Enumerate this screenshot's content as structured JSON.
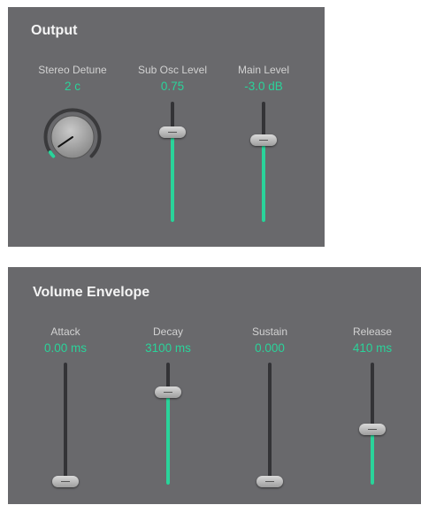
{
  "output": {
    "title": "Output",
    "stereo_detune": {
      "label": "Stereo Detune",
      "value": "2 c",
      "level": 0.04
    },
    "sub_osc_level": {
      "label": "Sub Osc Level",
      "value": "0.75",
      "level": 0.75
    },
    "main_level": {
      "label": "Main Level",
      "value": "-3.0 dB",
      "level": 0.68
    }
  },
  "volume_envelope": {
    "title": "Volume Envelope",
    "attack": {
      "label": "Attack",
      "value": "0.00 ms",
      "level": 0.0
    },
    "decay": {
      "label": "Decay",
      "value": "3100 ms",
      "level": 0.76
    },
    "sustain": {
      "label": "Sustain",
      "value": "0.000",
      "level": 0.0
    },
    "release": {
      "label": "Release",
      "value": "410 ms",
      "level": 0.45
    }
  },
  "colors": {
    "panel": "#69696c",
    "accent": "#2ad39a",
    "track": "#333336"
  }
}
